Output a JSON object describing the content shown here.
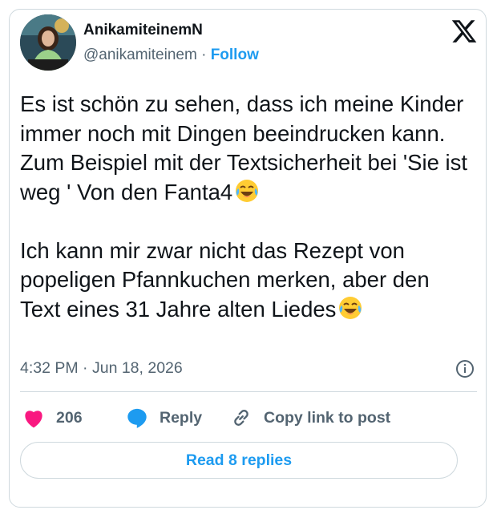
{
  "author": {
    "display_name": "AnikamiteinemN",
    "handle": "@anikamiteinem",
    "separator": "·",
    "follow_label": "Follow"
  },
  "tweet": {
    "paragraph1": "Es ist schön zu sehen, dass ich meine Kinder immer noch mit Dingen beeindrucken kann. Zum Beispiel mit der Textsicherheit bei 'Sie ist weg ' Von den Fanta4",
    "paragraph2": "Ich kann mir zwar nicht das Rezept von popeligen Pfannkuchen merken, aber den Text eines 31 Jahre alten Liedes",
    "emoji": "face-with-tears-of-joy-icon"
  },
  "meta": {
    "time": "4:32 PM",
    "separator": "·",
    "date": "Jun 18, 2026"
  },
  "actions": {
    "like_count": "206",
    "reply_label": "Reply",
    "copy_label": "Copy link to post"
  },
  "read_replies_label": "Read 8 replies",
  "colors": {
    "accent": "#1d9bf0",
    "like": "#f91880",
    "secondary_text": "#536471",
    "border": "#cfd9de"
  }
}
